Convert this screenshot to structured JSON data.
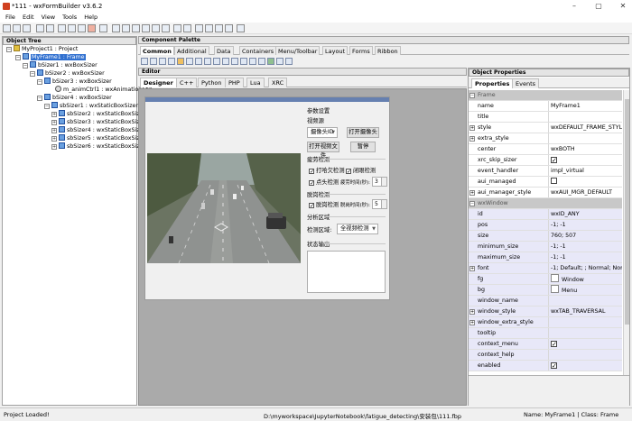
{
  "window": {
    "title": "*111 - wxFormBuilder v3.6.2",
    "buttons": {
      "minimize": "–",
      "maximize": "▢",
      "close": "✕"
    }
  },
  "menu": [
    "File",
    "Edit",
    "View",
    "Tools",
    "Help"
  ],
  "object_tree": {
    "header": "Object Tree",
    "project": "MyProject1 : Project",
    "items": [
      "MyFrame1 : Frame",
      "bSizer1 : wxBoxSizer",
      "bSizer2 : wxBoxSizer",
      "bSizer3 : wxBoxSizer",
      "m_animCtrl1 : wxAnimationCtrl",
      "bSizer4 : wxBoxSizer",
      "sbSizer1 : wxStaticBoxSizer",
      "sbSizer2 : wxStaticBoxSizer",
      "sbSizer3 : wxStaticBoxSizer",
      "sbSizer4 : wxStaticBoxSizer",
      "sbSizer5 : wxStaticBoxSizer",
      "sbSizer6 : wxStaticBoxSizer"
    ]
  },
  "palette": {
    "header": "Component Palette",
    "tabs": [
      "Common",
      "Additional",
      "Data",
      "Containers",
      "Menu/Toolbar",
      "Layout",
      "Forms",
      "Ribbon"
    ],
    "active_tab": "Common"
  },
  "editor": {
    "header": "Editor",
    "tabs": [
      "Designer",
      "C++",
      "Python",
      "PHP",
      "Lua",
      "XRC"
    ],
    "active_tab": "Designer",
    "form": {
      "params_label": "参数设置",
      "video_source_label": "视频源",
      "camera_combo": "摄像头ID",
      "open_camera_button": "打开摄像头",
      "open_video_button": "打开视频文件",
      "pause_button": "暂停",
      "fatigue_label": "疲劳检测",
      "blink_check": "打哈欠检测",
      "eye_check": "闭眼检测",
      "nod_check": "点头检测",
      "nod_duration_label": "疲劳时间(秒):",
      "nod_spin": "3",
      "distraction_label": "脱岗检测",
      "offduty_check": "脱岗检测",
      "offduty_duration_label": "脱岗时间(秒):",
      "offduty_spin": "5",
      "analysis_label": "分析区域",
      "detect_area_label": "检测区域:",
      "detect_area_combo": "全视频检测",
      "status_output_label": "状态输出"
    }
  },
  "properties": {
    "header": "Object Properties",
    "tabs": [
      "Properties",
      "Events"
    ],
    "active_tab": "Properties",
    "rows": [
      {
        "type": "cat",
        "name": "Frame"
      },
      {
        "name": "name",
        "value": "MyFrame1"
      },
      {
        "name": "title",
        "value": ""
      },
      {
        "name": "style",
        "value": "wxDEFAULT_FRAME_STYLE",
        "expander": true
      },
      {
        "name": "extra_style",
        "value": "",
        "expander": true
      },
      {
        "name": "center",
        "value": "wxBOTH"
      },
      {
        "name": "xrc_skip_sizer",
        "value": "",
        "checkbox": true,
        "checked": true
      },
      {
        "name": "event_handler",
        "value": "impl_virtual"
      },
      {
        "name": "aui_managed",
        "value": "",
        "checkbox": true,
        "checked": false
      },
      {
        "name": "aui_manager_style",
        "value": "wxAUI_MGR_DEFAULT",
        "expander": true
      },
      {
        "type": "cat",
        "name": "wxWindow"
      },
      {
        "name": "id",
        "value": "wxID_ANY",
        "sel": true
      },
      {
        "name": "pos",
        "value": "-1; -1",
        "sel": true
      },
      {
        "name": "size",
        "value": "760; 507",
        "sel": true
      },
      {
        "name": "minimum_size",
        "value": "-1; -1",
        "sel": true
      },
      {
        "name": "maximum_size",
        "value": "-1; -1",
        "sel": true
      },
      {
        "name": "font",
        "value": "-1; Default; ; Normal; Normal;",
        "expander": true,
        "sel": true
      },
      {
        "name": "fg",
        "value": "Window",
        "swatch": true,
        "sel": true
      },
      {
        "name": "bg",
        "value": "Menu",
        "swatch": true,
        "sel": true
      },
      {
        "name": "window_name",
        "value": "",
        "sel": true
      },
      {
        "name": "window_style",
        "value": "wxTAB_TRAVERSAL",
        "expander": true,
        "sel": true
      },
      {
        "name": "window_extra_style",
        "value": "",
        "expander": true,
        "sel": true
      },
      {
        "name": "tooltip",
        "value": "",
        "sel": true
      },
      {
        "name": "context_menu",
        "value": "",
        "checkbox": true,
        "checked": true,
        "sel": true
      },
      {
        "name": "context_help",
        "value": "",
        "sel": true
      },
      {
        "name": "enabled",
        "value": "",
        "checkbox": true,
        "checked": true,
        "sel": true
      }
    ]
  },
  "statusbar": {
    "left": "Project Loaded!",
    "path": "D:\\myworkspace\\JupyterNotebook\\fatigue_detecting\\安装包\\111.fbp",
    "right": "Name: MyFrame1 | Class: Frame"
  },
  "colors": {
    "selection": "#3070d0",
    "category_bg": "#c8c8c8",
    "editor_bg": "#aaaaaa"
  }
}
